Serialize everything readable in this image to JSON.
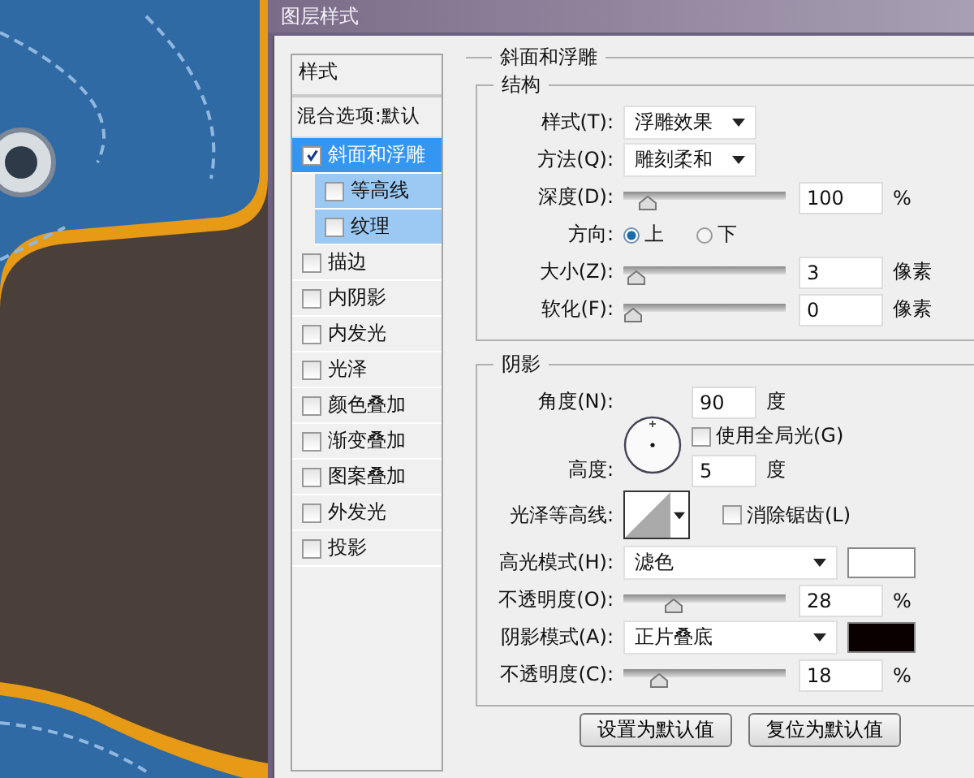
{
  "window": {
    "title": "图层样式"
  },
  "sidebar": {
    "header": "样式",
    "blending": "混合选项:默认",
    "items": [
      {
        "label": "斜面和浮雕",
        "checked": true,
        "selected": true,
        "children": [
          {
            "label": "等高线",
            "checked": false,
            "selected": false
          },
          {
            "label": "纹理",
            "checked": false,
            "selected": false
          }
        ]
      },
      {
        "label": "描边",
        "checked": false,
        "selected": false
      },
      {
        "label": "内阴影",
        "checked": false,
        "selected": false
      },
      {
        "label": "内发光",
        "checked": false,
        "selected": false
      },
      {
        "label": "光泽",
        "checked": false,
        "selected": false
      },
      {
        "label": "颜色叠加",
        "checked": false,
        "selected": false
      },
      {
        "label": "渐变叠加",
        "checked": false,
        "selected": false
      },
      {
        "label": "图案叠加",
        "checked": false,
        "selected": false
      },
      {
        "label": "外发光",
        "checked": false,
        "selected": false
      },
      {
        "label": "投影",
        "checked": false,
        "selected": false
      }
    ]
  },
  "bevel": {
    "title": "斜面和浮雕",
    "structure": {
      "title": "结构",
      "style": {
        "label": "样式(T):",
        "value": "浮雕效果"
      },
      "technique": {
        "label": "方法(Q):",
        "value": "雕刻柔和"
      },
      "depth": {
        "label": "深度(D):",
        "level": 0.1,
        "value": "100",
        "unit": "%"
      },
      "direction": {
        "label": "方向:",
        "options": [
          {
            "label": "上",
            "selected": true
          },
          {
            "label": "下",
            "selected": false
          }
        ]
      },
      "size": {
        "label": "大小(Z):",
        "level": 0.02,
        "value": "3",
        "unit": "像素"
      },
      "soften": {
        "label": "软化(F):",
        "level": 0,
        "value": "0",
        "unit": "像素"
      }
    },
    "shading": {
      "title": "阴影",
      "angle": {
        "label": "角度(N):",
        "value": "90",
        "unit": "度"
      },
      "global_light": {
        "label": "使用全局光(G)",
        "checked": false
      },
      "altitude": {
        "label": "高度:",
        "value": "5",
        "unit": "度"
      },
      "gloss_contour": {
        "label": "光泽等高线:"
      },
      "anti_aliased": {
        "label": "消除锯齿(L)",
        "checked": false
      },
      "highlight_mode": {
        "label": "高光模式(H):",
        "value": "滤色",
        "color": "#ffffff"
      },
      "highlight_opacity": {
        "label": "不透明度(O):",
        "level": 0.28,
        "value": "28",
        "unit": "%"
      },
      "shadow_mode": {
        "label": "阴影模式(A):",
        "value": "正片叠底",
        "color": "#0a0000"
      },
      "shadow_opacity": {
        "label": "不透明度(C):",
        "level": 0.18,
        "value": "18",
        "unit": "%"
      }
    }
  },
  "buttons": [
    "设置为默认值",
    "复位为默认值"
  ]
}
